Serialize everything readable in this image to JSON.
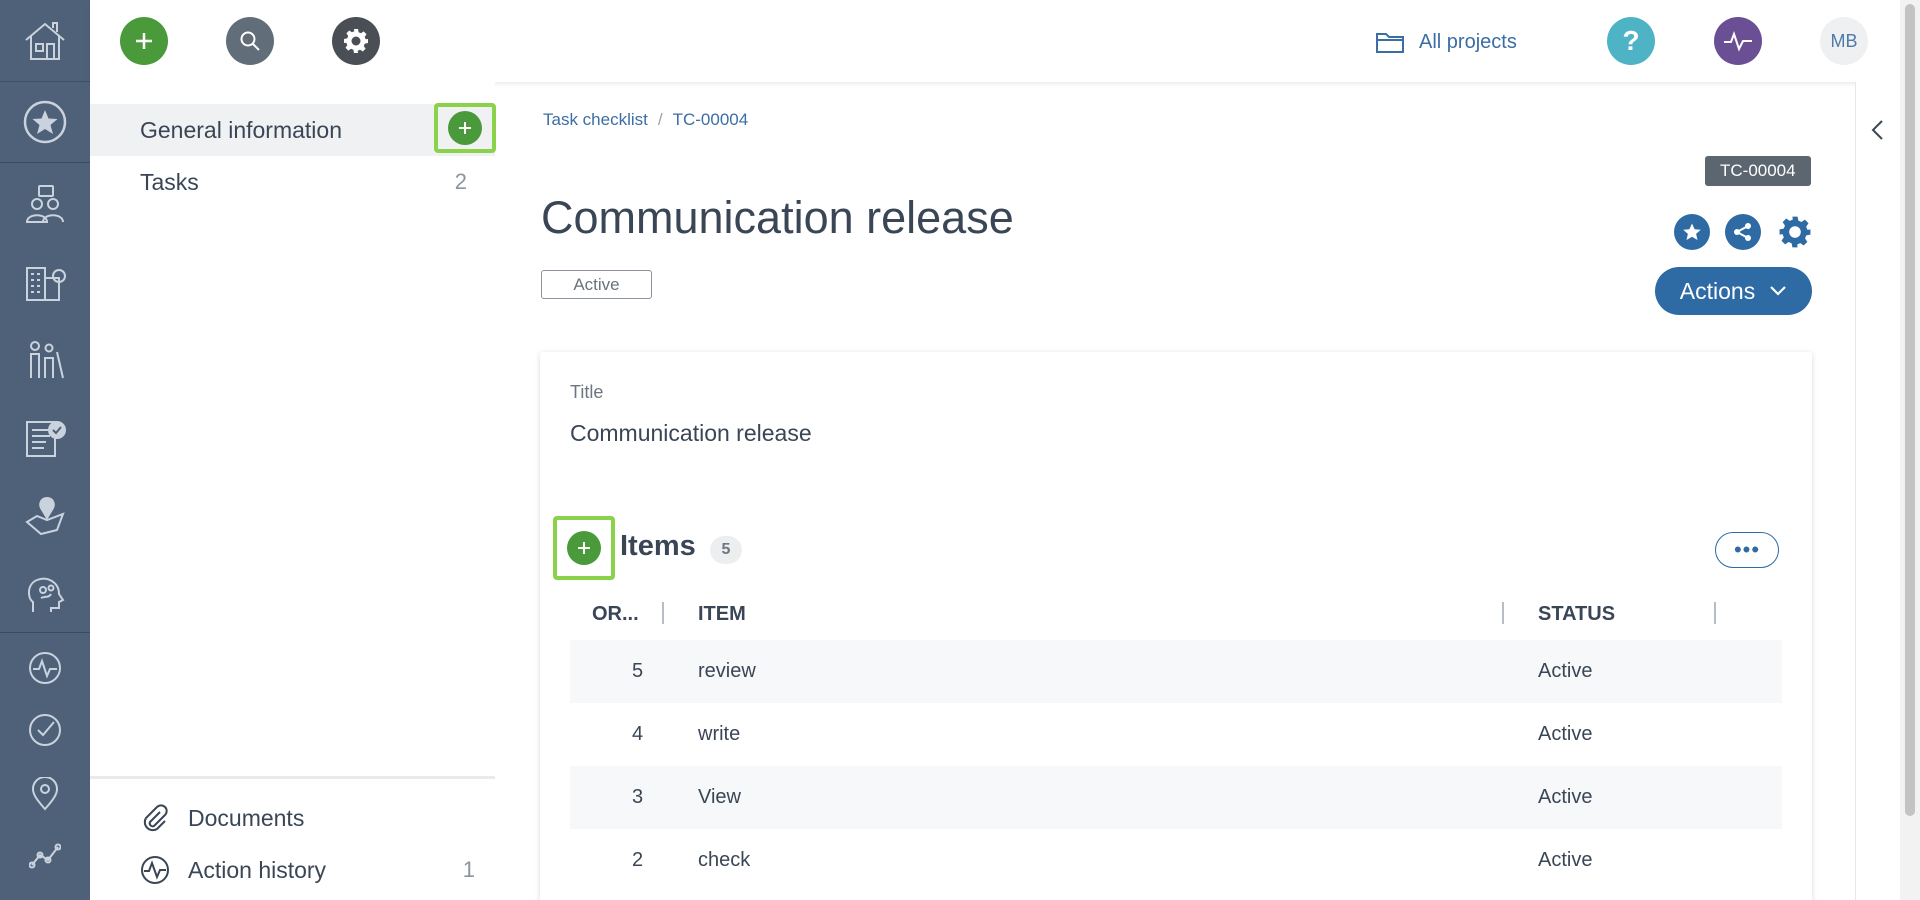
{
  "topbar": {
    "all_projects_label": "All projects",
    "help_glyph": "?",
    "avatar_initials": "MB"
  },
  "colors": {
    "rail": "#4e6179",
    "green": "#4a9a3b",
    "blue": "#2e6aa3",
    "highlight": "#8bd24c"
  },
  "leftnav": {
    "items": [
      {
        "label": "General information",
        "count": ""
      },
      {
        "label": "Tasks",
        "count": "2"
      }
    ],
    "bottom": [
      {
        "label": "Documents",
        "count": "",
        "icon": "paperclip-icon"
      },
      {
        "label": "Action history",
        "count": "1",
        "icon": "activity-icon"
      }
    ]
  },
  "breadcrumb": {
    "parent": "Task checklist",
    "separator": "/",
    "current": "TC-00004"
  },
  "record": {
    "id_badge": "TC-00004",
    "title": "Communication release",
    "status": "Active",
    "actions_label": "Actions"
  },
  "card": {
    "title_label": "Title",
    "title_value": "Communication release",
    "items_heading": "Items",
    "items_count": "5",
    "more_glyph": "•••",
    "columns": [
      "OR...",
      "ITEM",
      "STATUS"
    ],
    "rows": [
      {
        "order": "5",
        "item": "review",
        "status": "Active"
      },
      {
        "order": "4",
        "item": "write",
        "status": "Active"
      },
      {
        "order": "3",
        "item": "View",
        "status": "Active"
      },
      {
        "order": "2",
        "item": "check",
        "status": "Active"
      }
    ]
  },
  "rail_icons": [
    "home-icon",
    "star-icon",
    "people-chat-icon",
    "buildings-icon",
    "family-icon",
    "checklist-icon",
    "map-pin-region-icon",
    "head-ideas-icon",
    "activity-icon",
    "check-circle-icon",
    "location-icon",
    "chart-line-icon"
  ]
}
